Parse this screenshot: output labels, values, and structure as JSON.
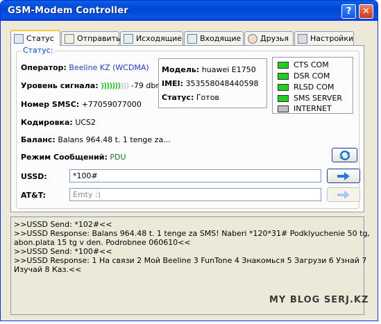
{
  "window": {
    "title": "GSM-Modem Controller",
    "help_label": "?",
    "close_label": "✕"
  },
  "tabs": [
    {
      "label": "Статус",
      "icon": "info-icon",
      "active": true
    },
    {
      "label": "Отправить",
      "icon": "send-icon"
    },
    {
      "label": "Исходящие",
      "icon": "outbox-icon"
    },
    {
      "label": "Входящие",
      "icon": "inbox-icon"
    },
    {
      "label": "Друзья",
      "icon": "friends-icon"
    },
    {
      "label": "Настройки",
      "icon": "settings-icon"
    }
  ],
  "status": {
    "group_label": "Статус:",
    "operator_label": "Оператор:",
    "operator_value": "Beeline KZ (WCDMA)",
    "signal_label": "Уровень сигнала:",
    "signal_bars_on": ")))))))",
    "signal_bars_off": ")))",
    "signal_value": "-79 dbm",
    "smsc_label": "Номер SMSC:",
    "smsc_value": "+77059077000",
    "encoding_label": "Кодировка:",
    "encoding_value": "UCS2",
    "balance_label": "Баланс:",
    "balance_value": "Balans 964.48 t. 1 tenge za...",
    "mode_label": "Режим Сообщений:",
    "mode_value": "PDU"
  },
  "device": {
    "model_label": "Модель:",
    "model_value": "huawei E1750",
    "imei_label": "IMEI:",
    "imei_value": "353558048440598",
    "state_label": "Статус:",
    "state_value": "Готов"
  },
  "indicators": [
    {
      "label": "CTS COM",
      "color": "#22cc22"
    },
    {
      "label": "DSR COM",
      "color": "#22cc22"
    },
    {
      "label": "RLSD COM",
      "color": "#22cc22"
    },
    {
      "label": "SMS SERVER",
      "color": "#22cc22"
    },
    {
      "label": "INTERNET",
      "color": "#c0c0c0"
    }
  ],
  "ussd": {
    "label": "USSD:",
    "value": "*100#"
  },
  "att": {
    "label": "AT&T:",
    "placeholder": "Emty :)"
  },
  "log": [
    ">>USSD Send: *102#<<",
    ">>USSD Response: Balans 964.48 t. 1 tenge za SMS! Naberi *120*31# Podklyuchenie 50 tg,",
    "abon.plata 15 tg v den. Podrobnee 060610<<",
    ">>USSD Send: *100#<<",
    ">>USSD Response: 1 На связи 2 Мой Beeline 3 FunTone 4 Знакомься 5 Загрузи 6 Узнай 7",
    "Изучай 8 Каз.<<"
  ],
  "watermark": "MY BLOG SERJ.KZ"
}
